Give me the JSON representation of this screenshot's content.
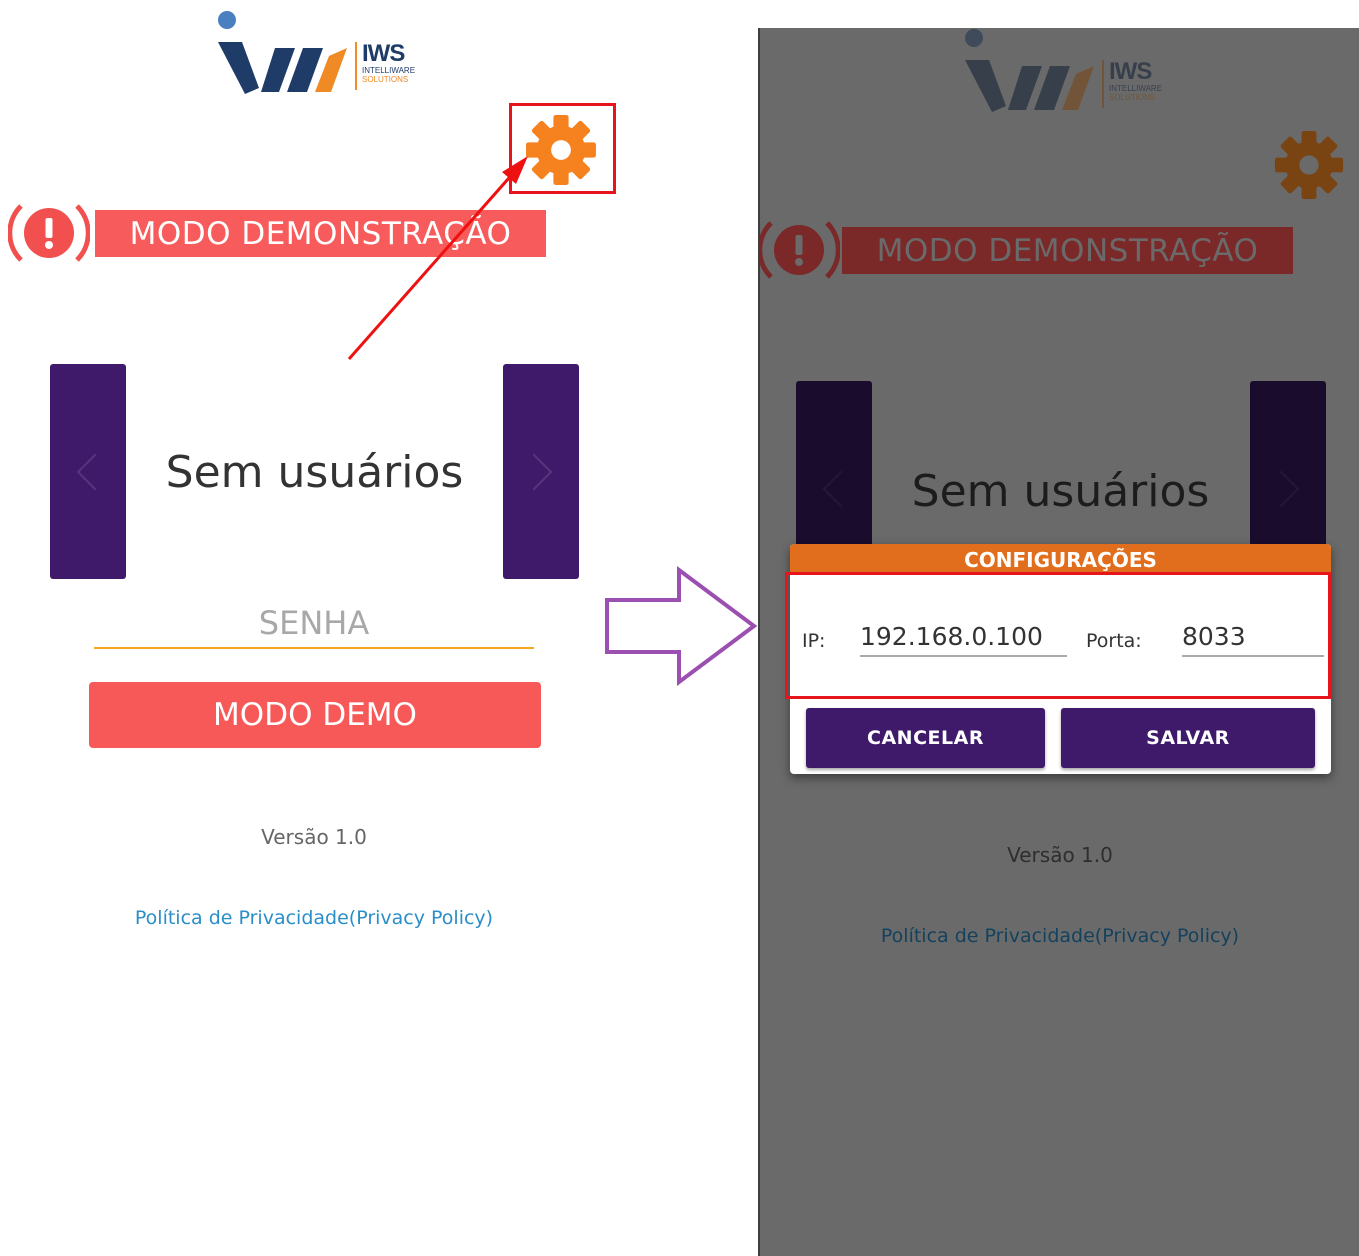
{
  "left_screen": {
    "logo": {
      "text": "IWS",
      "subtitle_line1": "INTELLIWARE",
      "subtitle_line2": "SOLUTIONS"
    },
    "settings_icon": "gear-icon",
    "alert_icon": "exclamation-alert-icon",
    "demo_banner": "MODO DEMONSTRAÇÃO",
    "user_carousel": {
      "text": "Sem usuários",
      "prev_icon": "chevron-left-icon",
      "next_icon": "chevron-right-icon"
    },
    "password_placeholder": "SENHA",
    "demo_button": "MODO DEMO",
    "version": "Versão 1.0",
    "privacy_link": "Política de Privacidade(Privacy Policy)"
  },
  "right_screen": {
    "logo": {
      "text": "IWS",
      "subtitle_line1": "INTELLIWARE",
      "subtitle_line2": "SOLUTIONS"
    },
    "demo_banner": "MODO DEMONSTRAÇÃO",
    "user_carousel": {
      "text": "Sem usuários"
    },
    "version": "Versão 1.0",
    "privacy_link": "Política de Privacidade(Privacy Policy)",
    "dialog": {
      "title": "CONFIGURAÇÕES",
      "ip_label": "IP:",
      "ip_value": "192.168.0.100",
      "port_label": "Porta:",
      "port_value": "8033",
      "cancel_button": "CANCELAR",
      "save_button": "SALVAR"
    }
  },
  "colors": {
    "brand_purple": "#3f1a6b",
    "accent_orange": "#f5821f",
    "alert_red": "#f75b5b",
    "highlight_red": "#e8141c",
    "transition_arrow": "#9b4fb0",
    "link_blue": "#2a8ec9"
  }
}
